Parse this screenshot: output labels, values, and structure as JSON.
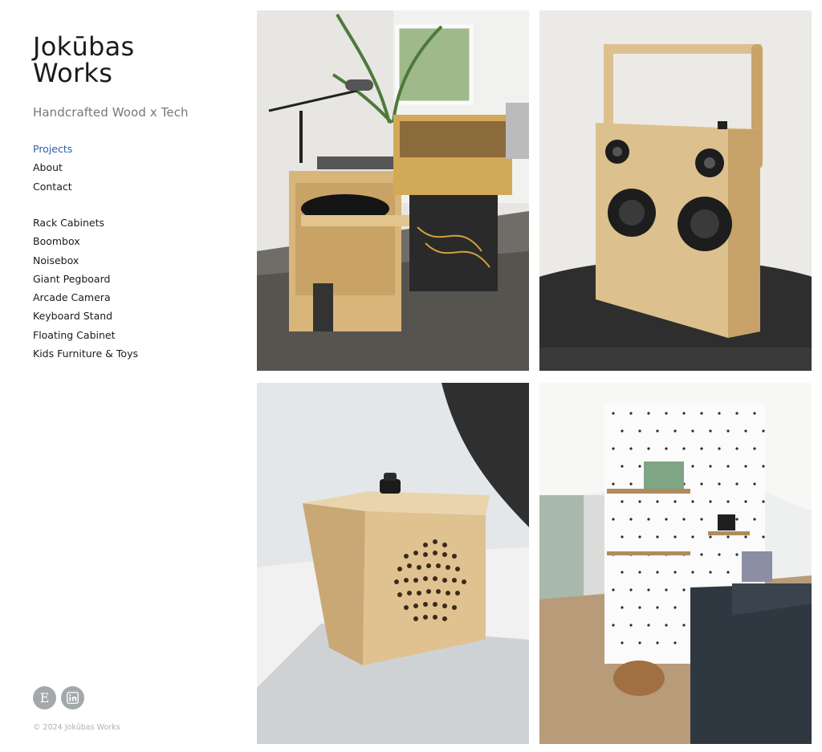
{
  "brand": {
    "name": "Jokūbas\nWorks",
    "tagline": "Handcrafted Wood x Tech"
  },
  "nav": [
    {
      "label": "Projects",
      "active": true
    },
    {
      "label": "About",
      "active": false
    },
    {
      "label": "Contact",
      "active": false
    }
  ],
  "projects": [
    "Rack Cabinets",
    "Boombox",
    "Noisebox",
    "Giant Pegboard",
    "Arcade Camera",
    "Keyboard Stand",
    "Floating Cabinet",
    "Kids Furniture & Toys"
  ],
  "social": [
    {
      "icon": "etsy-icon",
      "glyph": "E"
    },
    {
      "icon": "linkedin-icon"
    }
  ],
  "footer": {
    "copyright": "© 2024 Jokūbas Works"
  },
  "gallery": [
    {
      "subject": "rack-cabinets-photo"
    },
    {
      "subject": "boombox-photo"
    },
    {
      "subject": "noisebox-photo"
    },
    {
      "subject": "giant-pegboard-photo"
    }
  ],
  "colors": {
    "accent": "#2a5fae",
    "text": "#1a1a1a",
    "muted": "#777777",
    "social_bg": "#a3a8ab",
    "plywood": "#d9b98a"
  }
}
